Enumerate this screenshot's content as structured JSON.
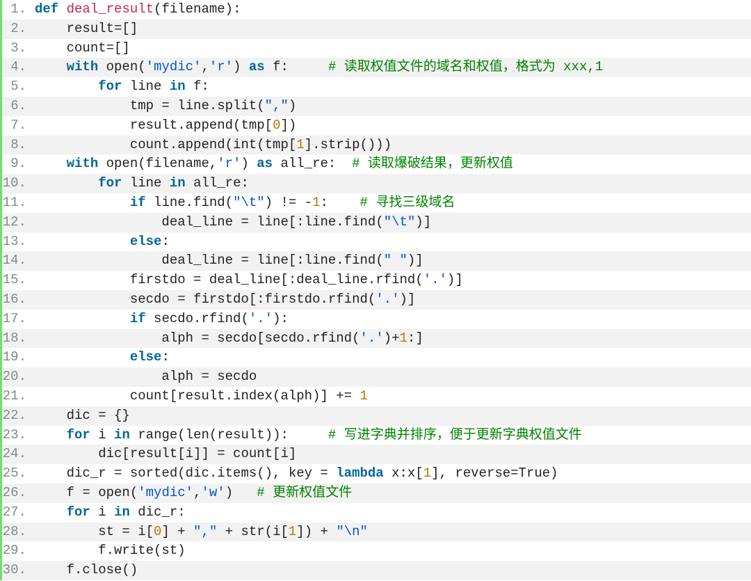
{
  "lines": [
    {
      "n": "1.",
      "tokens": [
        {
          "cls": "kw",
          "t": "def"
        },
        {
          "cls": "pln",
          "t": " "
        },
        {
          "cls": "fn",
          "t": "deal_result"
        },
        {
          "cls": "pln",
          "t": "(filename):"
        }
      ]
    },
    {
      "n": "2.",
      "tokens": [
        {
          "cls": "pln",
          "t": "    result=[]"
        }
      ]
    },
    {
      "n": "3.",
      "tokens": [
        {
          "cls": "pln",
          "t": "    count=[]"
        }
      ]
    },
    {
      "n": "4.",
      "tokens": [
        {
          "cls": "pln",
          "t": "    "
        },
        {
          "cls": "kw",
          "t": "with"
        },
        {
          "cls": "pln",
          "t": " open("
        },
        {
          "cls": "str",
          "t": "'mydic'"
        },
        {
          "cls": "pln",
          "t": ","
        },
        {
          "cls": "str",
          "t": "'r'"
        },
        {
          "cls": "pln",
          "t": ") "
        },
        {
          "cls": "kw",
          "t": "as"
        },
        {
          "cls": "pln",
          "t": " f:     "
        },
        {
          "cls": "cmt",
          "t": "# 读取权值文件的域名和权值，格式为 xxx,1"
        }
      ]
    },
    {
      "n": "5.",
      "tokens": [
        {
          "cls": "pln",
          "t": "        "
        },
        {
          "cls": "kw",
          "t": "for"
        },
        {
          "cls": "pln",
          "t": " line "
        },
        {
          "cls": "kw",
          "t": "in"
        },
        {
          "cls": "pln",
          "t": " f:"
        }
      ]
    },
    {
      "n": "6.",
      "tokens": [
        {
          "cls": "pln",
          "t": "            tmp = line.split("
        },
        {
          "cls": "str",
          "t": "\",\""
        },
        {
          "cls": "pln",
          "t": ")"
        }
      ]
    },
    {
      "n": "7.",
      "tokens": [
        {
          "cls": "pln",
          "t": "            result.append(tmp["
        },
        {
          "cls": "num",
          "t": "0"
        },
        {
          "cls": "pln",
          "t": "])"
        }
      ]
    },
    {
      "n": "8.",
      "tokens": [
        {
          "cls": "pln",
          "t": "            count.append(int(tmp["
        },
        {
          "cls": "num",
          "t": "1"
        },
        {
          "cls": "pln",
          "t": "].strip()))"
        }
      ]
    },
    {
      "n": "9.",
      "tokens": [
        {
          "cls": "pln",
          "t": "    "
        },
        {
          "cls": "kw",
          "t": "with"
        },
        {
          "cls": "pln",
          "t": " open(filename,"
        },
        {
          "cls": "str",
          "t": "'r'"
        },
        {
          "cls": "pln",
          "t": ") "
        },
        {
          "cls": "kw",
          "t": "as"
        },
        {
          "cls": "pln",
          "t": " all_re:  "
        },
        {
          "cls": "cmt",
          "t": "# 读取爆破结果，更新权值"
        }
      ]
    },
    {
      "n": "10.",
      "tokens": [
        {
          "cls": "pln",
          "t": "        "
        },
        {
          "cls": "kw",
          "t": "for"
        },
        {
          "cls": "pln",
          "t": " line "
        },
        {
          "cls": "kw",
          "t": "in"
        },
        {
          "cls": "pln",
          "t": " all_re:"
        }
      ]
    },
    {
      "n": "11.",
      "tokens": [
        {
          "cls": "pln",
          "t": "            "
        },
        {
          "cls": "kw",
          "t": "if"
        },
        {
          "cls": "pln",
          "t": " line.find("
        },
        {
          "cls": "str",
          "t": "\"\\t\""
        },
        {
          "cls": "pln",
          "t": ") != -"
        },
        {
          "cls": "num",
          "t": "1"
        },
        {
          "cls": "pln",
          "t": ":    "
        },
        {
          "cls": "cmt",
          "t": "# 寻找三级域名"
        }
      ]
    },
    {
      "n": "12.",
      "tokens": [
        {
          "cls": "pln",
          "t": "                deal_line = line[:line.find("
        },
        {
          "cls": "str",
          "t": "\"\\t\""
        },
        {
          "cls": "pln",
          "t": ")]"
        }
      ]
    },
    {
      "n": "13.",
      "tokens": [
        {
          "cls": "pln",
          "t": "            "
        },
        {
          "cls": "kw",
          "t": "else"
        },
        {
          "cls": "pln",
          "t": ":"
        }
      ]
    },
    {
      "n": "14.",
      "tokens": [
        {
          "cls": "pln",
          "t": "                deal_line = line[:line.find("
        },
        {
          "cls": "str",
          "t": "\" \""
        },
        {
          "cls": "pln",
          "t": ")]"
        }
      ]
    },
    {
      "n": "15.",
      "tokens": [
        {
          "cls": "pln",
          "t": "            firstdo = deal_line[:deal_line.rfind("
        },
        {
          "cls": "str",
          "t": "'.'"
        },
        {
          "cls": "pln",
          "t": ")]"
        }
      ]
    },
    {
      "n": "16.",
      "tokens": [
        {
          "cls": "pln",
          "t": "            secdo = firstdo[:firstdo.rfind("
        },
        {
          "cls": "str",
          "t": "'.'"
        },
        {
          "cls": "pln",
          "t": ")]"
        }
      ]
    },
    {
      "n": "17.",
      "tokens": [
        {
          "cls": "pln",
          "t": "            "
        },
        {
          "cls": "kw",
          "t": "if"
        },
        {
          "cls": "pln",
          "t": " secdo.rfind("
        },
        {
          "cls": "str",
          "t": "'.'"
        },
        {
          "cls": "pln",
          "t": "):"
        }
      ]
    },
    {
      "n": "18.",
      "tokens": [
        {
          "cls": "pln",
          "t": "                alph = secdo[secdo.rfind("
        },
        {
          "cls": "str",
          "t": "'.'"
        },
        {
          "cls": "pln",
          "t": ")+"
        },
        {
          "cls": "num",
          "t": "1"
        },
        {
          "cls": "pln",
          "t": ":]"
        }
      ]
    },
    {
      "n": "19.",
      "tokens": [
        {
          "cls": "pln",
          "t": "            "
        },
        {
          "cls": "kw",
          "t": "else"
        },
        {
          "cls": "pln",
          "t": ":"
        }
      ]
    },
    {
      "n": "20.",
      "tokens": [
        {
          "cls": "pln",
          "t": "                alph = secdo"
        }
      ]
    },
    {
      "n": "21.",
      "tokens": [
        {
          "cls": "pln",
          "t": "            count[result.index(alph)] += "
        },
        {
          "cls": "num",
          "t": "1"
        }
      ]
    },
    {
      "n": "22.",
      "tokens": [
        {
          "cls": "pln",
          "t": "    dic = {}"
        }
      ]
    },
    {
      "n": "23.",
      "tokens": [
        {
          "cls": "pln",
          "t": "    "
        },
        {
          "cls": "kw",
          "t": "for"
        },
        {
          "cls": "pln",
          "t": " i "
        },
        {
          "cls": "kw",
          "t": "in"
        },
        {
          "cls": "pln",
          "t": " range(len(result)):     "
        },
        {
          "cls": "cmt",
          "t": "# 写进字典并排序，便于更新字典权值文件"
        }
      ]
    },
    {
      "n": "24.",
      "tokens": [
        {
          "cls": "pln",
          "t": "        dic[result[i]] = count[i]"
        }
      ]
    },
    {
      "n": "25.",
      "tokens": [
        {
          "cls": "pln",
          "t": "    dic_r = sorted(dic.items(), key = "
        },
        {
          "cls": "kw",
          "t": "lambda"
        },
        {
          "cls": "pln",
          "t": " x:x["
        },
        {
          "cls": "num",
          "t": "1"
        },
        {
          "cls": "pln",
          "t": "], reverse=True)"
        }
      ]
    },
    {
      "n": "26.",
      "tokens": [
        {
          "cls": "pln",
          "t": "    f = open("
        },
        {
          "cls": "str",
          "t": "'mydic'"
        },
        {
          "cls": "pln",
          "t": ","
        },
        {
          "cls": "str",
          "t": "'w'"
        },
        {
          "cls": "pln",
          "t": ")   "
        },
        {
          "cls": "cmt",
          "t": "# 更新权值文件"
        }
      ]
    },
    {
      "n": "27.",
      "tokens": [
        {
          "cls": "pln",
          "t": "    "
        },
        {
          "cls": "kw",
          "t": "for"
        },
        {
          "cls": "pln",
          "t": " i "
        },
        {
          "cls": "kw",
          "t": "in"
        },
        {
          "cls": "pln",
          "t": " dic_r:"
        }
      ]
    },
    {
      "n": "28.",
      "tokens": [
        {
          "cls": "pln",
          "t": "        st = i["
        },
        {
          "cls": "num",
          "t": "0"
        },
        {
          "cls": "pln",
          "t": "] + "
        },
        {
          "cls": "str",
          "t": "\",\""
        },
        {
          "cls": "pln",
          "t": " + str(i["
        },
        {
          "cls": "num",
          "t": "1"
        },
        {
          "cls": "pln",
          "t": "]) + "
        },
        {
          "cls": "str",
          "t": "\"\\n\""
        }
      ]
    },
    {
      "n": "29.",
      "tokens": [
        {
          "cls": "pln",
          "t": "        f.write(st)"
        }
      ]
    },
    {
      "n": "30.",
      "tokens": [
        {
          "cls": "pln",
          "t": "    f.close()"
        }
      ]
    }
  ]
}
